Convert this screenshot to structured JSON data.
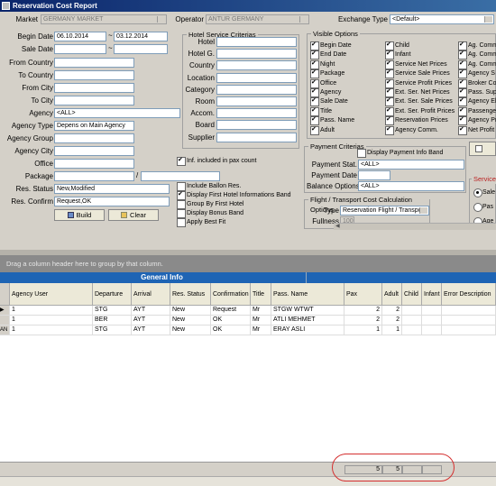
{
  "window": {
    "title": "Reservation Cost Report"
  },
  "top": {
    "market_label": "Market",
    "market_value": "GERMANY MARKET",
    "operator_label": "Operator",
    "operator_value": "ANTUR GERMANY",
    "exchange_label": "Exchange Type",
    "exchange_value": "<Default>"
  },
  "filters": {
    "begin_date_label": "Begin Date",
    "begin_date_from": "06.10.2014",
    "begin_date_sep": "~",
    "begin_date_to": "03.12.2014",
    "sale_date_label": "Sale Date",
    "sale_date_sep": "~",
    "from_country_label": "From Country",
    "to_country_label": "To Country",
    "from_city_label": "From City",
    "to_city_label": "To City",
    "agency_label": "Agency",
    "agency_value": "<ALL>",
    "agency_type_label": "Agency Type",
    "agency_type_value": "Depens on Main Agency",
    "agency_group_label": "Agency Group",
    "agency_city_label": "Agency City",
    "office_label": "Office",
    "package_label": "Package",
    "package_sep": "/",
    "res_status_label": "Res. Status",
    "res_status_value": "New,Modified",
    "res_confirm_label": "Res. Confirm",
    "res_confirm_value": "Request,OK",
    "build_label": "Build",
    "clear_label": "Clear"
  },
  "hotel": {
    "group_title": "Hotel Service Criterias",
    "fields": [
      "Hotel",
      "Hotel G.",
      "Country",
      "Location",
      "Category",
      "Room",
      "Accom.",
      "Board",
      "Supplier"
    ],
    "inf_included_label": "Inf. included in pax count",
    "options": [
      {
        "label": "Include Ballon Res.",
        "checked": false
      },
      {
        "label": "Display First Hotel Informations Band",
        "checked": true
      },
      {
        "label": "Group By First Hotel",
        "checked": false
      },
      {
        "label": "Display Bonus Band",
        "checked": false
      },
      {
        "label": "Apply Best Fit",
        "checked": false
      }
    ]
  },
  "visible": {
    "group_title": "Visible Options",
    "col1": [
      "Begin Date",
      "End Date",
      "Night",
      "Package",
      "Office",
      "Agency",
      "Sale Date",
      "Title",
      "Pass. Name",
      "Adult"
    ],
    "col2": [
      "Child",
      "Infant",
      "Service Net Prices",
      "Service Sale Prices",
      "Service Profit Prices",
      "Ext. Ser. Net Prices",
      "Ext. Ser. Sale Prices",
      "Ext. Ser. Profit Prices",
      "Reservation Prices",
      "Agency Comm."
    ],
    "col3": [
      "Ag. Comm",
      "Ag. Comm",
      "Ag. Comm",
      "Agency S",
      "Broker Co",
      "Pass. Sup",
      "Agency El",
      "Passenge",
      "Agency Pr",
      "Net Profit"
    ]
  },
  "payment": {
    "group_title": "Payment Criterias",
    "display_band_label": "Display Payment Info Band",
    "stat_label": "Payment Stat.",
    "stat_value": "<ALL>",
    "date_label": "Payment Date",
    "balance_label": "Balance Options",
    "balance_value": "<ALL>"
  },
  "flight": {
    "group_title": "Flight / Transport Cost Calculation Options",
    "type_label": "Type",
    "type_value": "Reservation Flight / Transpo",
    "fullness_label": "Fullness",
    "fullness_value": "100"
  },
  "service": {
    "group_title": "Service",
    "options": [
      {
        "label": "Sale",
        "on": true
      },
      {
        "label": "Pas",
        "on": false
      },
      {
        "label": "Age",
        "on": false
      }
    ]
  },
  "grid": {
    "group_hint": "Drag a column header here to group by that column.",
    "band_label": "General Info",
    "columns": [
      "Agency User",
      "Departure",
      "Arrival",
      "Res. Status",
      "Confirmation",
      "Title",
      "Pass. Name",
      "Pax",
      "Adult",
      "Child",
      "Infant",
      "Error Description"
    ],
    "rows": [
      {
        "prefix": "",
        "cells": [
          "1",
          "STG",
          "AYT",
          "New",
          "Request",
          "Mr",
          "STGW WTWT",
          "2",
          "2",
          "",
          "",
          ""
        ]
      },
      {
        "prefix": "",
        "cells": [
          "1",
          "BER",
          "AYT",
          "New",
          "OK",
          "Mr",
          "ATLI MEHMET",
          "2",
          "2",
          "",
          "",
          ""
        ]
      },
      {
        "prefix": "AN",
        "cells": [
          "1",
          "STG",
          "AYT",
          "New",
          "OK",
          "Mr",
          "ERAY ASLI",
          "1",
          "1",
          "",
          "",
          ""
        ]
      }
    ],
    "footer": {
      "pax_total": "5",
      "adult_total": "5"
    }
  }
}
